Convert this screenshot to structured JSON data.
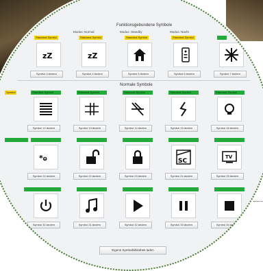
{
  "window": {
    "section_function": "Funktionsgebundene Symbole",
    "section_normal": "Normale Symbole",
    "footer_button": "Eigene Symbolbibliothek laden"
  },
  "function_columns": [
    "Modus: Normal",
    "Modus: Standby",
    "Modus: Nacht"
  ],
  "yellow_tags": [
    "Standard-Symbol",
    "Standard-Symbol",
    "Standard-Symbol",
    "Standard-Symbol"
  ],
  "left_tag": "Symbol",
  "function_buttons": [
    "Symbol 3 ändern",
    "Symbol 4 ändern",
    "Symbol 5 ändern",
    "Symbol 6 ändern",
    "Symbol 7 ändern"
  ],
  "row1_buttons": [
    "Symbol 12 ändern",
    "Symbol 13 ändern",
    "Symbol 14 ändern",
    "Symbol 15 ändern",
    "Symbol 16 ändern"
  ],
  "row2_buttons": [
    "Symbol 22 ändern",
    "Symbol 22 ändern",
    "Symbol 23 ändern",
    "Symbol 24 ändern",
    "Symbol 25 ändern"
  ],
  "row3_buttons": [
    "Symbol 30 ändern",
    "Symbol 31 ändern",
    "Symbol 32 ändern",
    "Symbol 33 ändern",
    "Symbol 34 ändern"
  ],
  "green_tag": "Standard-Symbol",
  "icons": {
    "function_row": [
      "sleep-zzz-icon",
      "sleep-zzz-icon",
      "house-icon",
      "remote-control-icon",
      "snowflake-sun-icon"
    ],
    "row1": [
      "hamburger-lines-icon",
      "sliders-icon",
      "strikethrough-icon",
      "rope-icon",
      "bulb-icon"
    ],
    "row2": [
      "dialog-icon",
      "unlocked-padlock-icon",
      "locked-padlock-icon",
      "sc-icon",
      "tv-icon"
    ],
    "row3": [
      "power-icon",
      "music-note-icon",
      "play-icon",
      "pause-icon",
      "stop-icon"
    ]
  },
  "colors": {
    "yellow": "#f4d30d",
    "green": "#22aa3a",
    "ring": "#4a7b2e"
  }
}
